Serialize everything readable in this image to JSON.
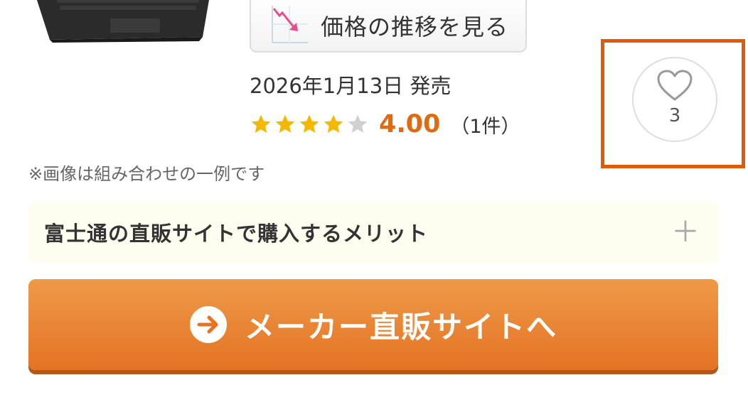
{
  "product": {
    "price_history_button": "価格の推移を見る",
    "release_date": "2026年1月13日 発売",
    "rating": {
      "stars_filled": 4,
      "stars_total": 5,
      "score": "4.00",
      "review_count": "（1件）"
    },
    "image_note": "※画像は組み合わせの一例です"
  },
  "favorite": {
    "icon": "heart-outline-icon",
    "count": "3",
    "highlight_color": "#e05a0a"
  },
  "merit_accordion": {
    "title": "富士通の直販サイトで購入するメリット",
    "icon": "plus-icon"
  },
  "cta": {
    "label": "メーカー直販サイトへ",
    "icon": "arrow-right-circle-icon"
  },
  "colors": {
    "accent_orange": "#e06a12",
    "star_filled": "#f5b800",
    "star_empty": "#d0d0d0"
  }
}
